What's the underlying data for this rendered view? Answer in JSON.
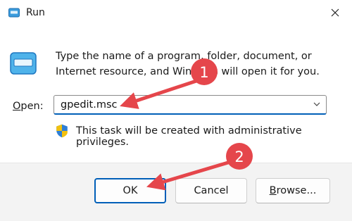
{
  "window": {
    "title": "Run"
  },
  "description": "Type the name of a program, folder, document, or Internet resource, and Windows will open it for you.",
  "open_field": {
    "label": "Open:",
    "label_accel": "O",
    "label_rest": "pen:",
    "value": "gpedit.msc"
  },
  "admin_note": "This task will be created with administrative privileges.",
  "buttons": {
    "ok": "OK",
    "cancel": "Cancel",
    "browse_accel": "B",
    "browse_rest": "rowse..."
  },
  "annotations": [
    {
      "number": "1",
      "color": "#e5464b"
    },
    {
      "number": "2",
      "color": "#e5464b"
    }
  ],
  "colors": {
    "accent": "#005fb8",
    "annotation": "#e5464b",
    "footer": "#f3f3f3"
  }
}
